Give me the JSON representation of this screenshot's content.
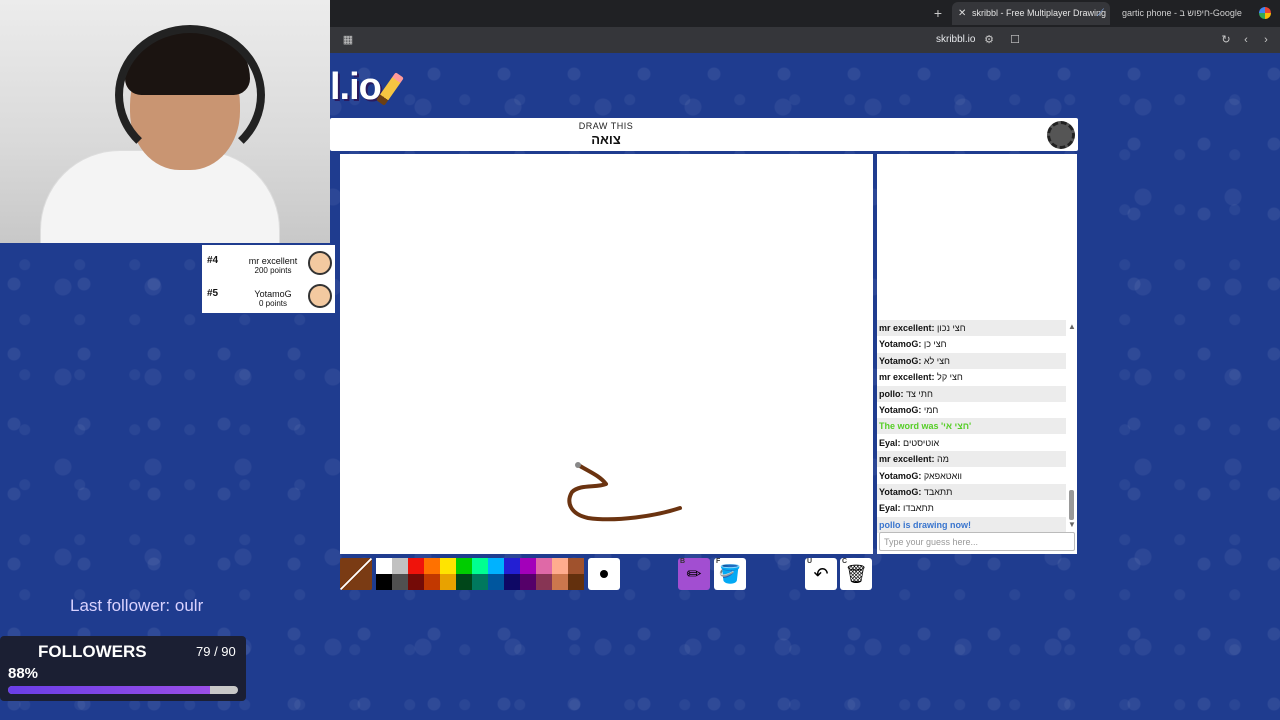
{
  "browser": {
    "active_tab": "skribbl - Free Multiplayer Drawing",
    "other_tab": "gartic phone - חיפוש ב-Google",
    "address": "skribbl.io"
  },
  "game": {
    "logo": "l.io",
    "draw_label": "DRAW THIS",
    "word": "צואה"
  },
  "players": [
    {
      "rank": "#4",
      "name": "mr excellent",
      "points": "200 points"
    },
    {
      "rank": "#5",
      "name": "YotamoG",
      "points": "0 points"
    }
  ],
  "chat": {
    "messages": [
      {
        "user": "mr excellent:",
        "text": "חצי נכון",
        "style": "normal"
      },
      {
        "user": "YotamoG:",
        "text": "חצי כן",
        "style": "normal"
      },
      {
        "user": "YotamoG:",
        "text": "חצי לא",
        "style": "normal"
      },
      {
        "user": "mr excellent:",
        "text": "חצי קל",
        "style": "normal"
      },
      {
        "user": "pollo:",
        "text": "חתי צד",
        "style": "normal"
      },
      {
        "user": "YotamoG:",
        "text": "חמי",
        "style": "normal"
      },
      {
        "user": "",
        "text": "The word was 'חצי אי'",
        "style": "green"
      },
      {
        "user": "Eyal:",
        "text": "אוטיסטים",
        "style": "normal"
      },
      {
        "user": "mr excellent:",
        "text": "מה",
        "style": "normal"
      },
      {
        "user": "YotamoG:",
        "text": "וואטאפאק",
        "style": "normal"
      },
      {
        "user": "YotamoG:",
        "text": "תתאבד",
        "style": "normal"
      },
      {
        "user": "Eyal:",
        "text": "תתאבדו",
        "style": "normal"
      },
      {
        "user": "",
        "text": "pollo is drawing now!",
        "style": "blue"
      }
    ],
    "placeholder": "Type your guess here..."
  },
  "toolbar": {
    "current_color": "#7a3b14",
    "palette": [
      "#ffffff",
      "#c1c1c1",
      "#ef130b",
      "#ff7100",
      "#ffe400",
      "#00cc00",
      "#00ff91",
      "#00b2ff",
      "#231fd3",
      "#a300ba",
      "#df69a7",
      "#ffac8e",
      "#a0522d",
      "#000000",
      "#505050",
      "#740b07",
      "#c23800",
      "#e8a200",
      "#004619",
      "#00785d",
      "#00569e",
      "#0e0865",
      "#550069",
      "#873554",
      "#cc774d",
      "#63300d"
    ],
    "tools": [
      {
        "name": "pencil",
        "key": "B",
        "glyph": "✏"
      },
      {
        "name": "fill",
        "key": "F",
        "glyph": "🪣"
      },
      {
        "name": "undo",
        "key": "U",
        "glyph": "↶"
      },
      {
        "name": "clear",
        "key": "C",
        "glyph": "🗑"
      }
    ]
  },
  "stream": {
    "last_follower": "Last follower: oulr",
    "followers_label": "FOLLOWERS",
    "followers_count": "79 / 90",
    "followers_percent": "88%",
    "progress": 0.88
  }
}
